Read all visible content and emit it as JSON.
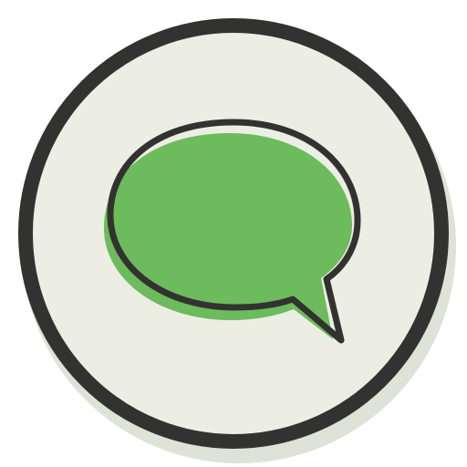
{
  "icon": {
    "name": "speech-bubble-icon",
    "colors": {
      "badge_fill": "#eceee4",
      "badge_shadow": "#dfe2d6",
      "ring": "#323330",
      "bubble_fill": "#6cbb5c",
      "bubble_outline": "#323330"
    }
  }
}
